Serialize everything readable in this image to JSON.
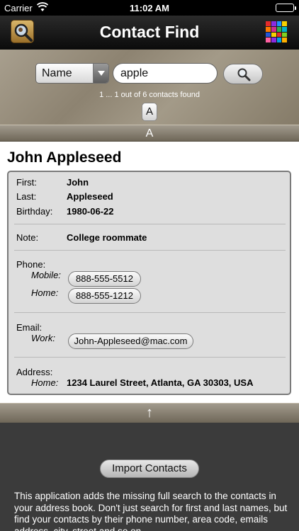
{
  "status_bar": {
    "carrier": "Carrier",
    "time": "11:02 AM"
  },
  "navbar": {
    "title": "Contact Find",
    "left_icon": "magnifier-app-icon",
    "right_icon": "color-grid-icon"
  },
  "search": {
    "field_select": "Name",
    "query": "apple",
    "results_text": "1 ... 1 out of 6 contacts found",
    "index_button": "A"
  },
  "section_header": "A",
  "contact": {
    "name": "John Appleseed",
    "first_label": "First:",
    "first": "John",
    "last_label": "Last:",
    "last": "Appleseed",
    "birthday_label": "Birthday:",
    "birthday": "1980-06-22",
    "note_label": "Note:",
    "note": "College roommate",
    "phone_label": "Phone:",
    "phones": [
      {
        "label": "Mobile:",
        "value": "888-555-5512"
      },
      {
        "label": "Home:",
        "value": "888-555-1212"
      }
    ],
    "email_label": "Email:",
    "emails": [
      {
        "label": "Work:",
        "value": "John-Appleseed@mac.com"
      }
    ],
    "address_label": "Address:",
    "addresses": [
      {
        "label": "Home:",
        "value": "1234 Laurel Street, Atlanta, GA 30303, USA"
      }
    ]
  },
  "scroll_top_glyph": "↑",
  "bottom": {
    "import_button": "Import Contacts",
    "description": "This application adds the missing full search to the contacts in your address book. Don't just search for first and last names, but find your contacts by their phone number, area code, emails address, city, street and so on."
  },
  "colors": {
    "section_bar": "#8a8272",
    "card_bg": "#dedede",
    "bottom_bg": "#3b3b3b"
  }
}
